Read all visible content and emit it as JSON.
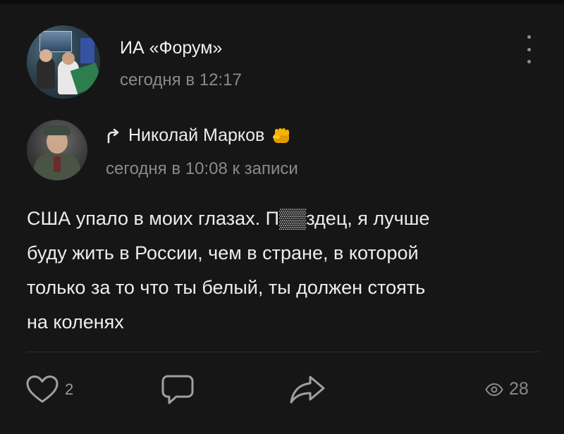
{
  "post": {
    "author": "ИА «Форум»",
    "time": "сегодня в 12:17"
  },
  "repost": {
    "author": "Николай Марков",
    "time": "сегодня в 10:08 к записи"
  },
  "body": {
    "lines": [
      "США упало в моих глазах. П▒▒здец, я лучше",
      "буду жить в России, чем в стране, в которой",
      "только за то что ты белый, ты должен стоять",
      "на коленях"
    ]
  },
  "actions": {
    "likes": "2",
    "views": "28"
  },
  "icons": {
    "menu": "more-vertical-icon",
    "repost": "repost-arrow-icon",
    "badge": "fist-icon",
    "like": "heart-icon",
    "comment": "comment-icon",
    "share": "share-icon",
    "views": "eye-icon"
  },
  "colors": {
    "background": "#161616",
    "text": "#ededed",
    "secondary": "#8a8a8a",
    "fist": "#f0a000"
  }
}
